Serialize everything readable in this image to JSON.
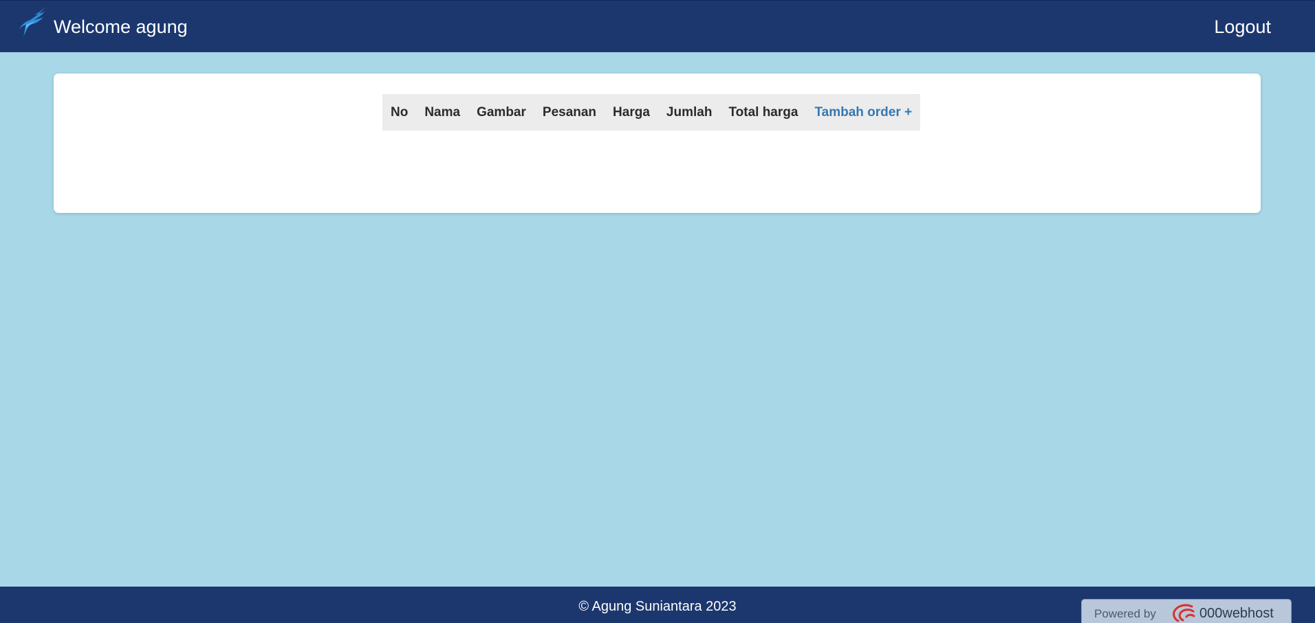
{
  "header": {
    "logo_icon": "bird-logo-icon",
    "welcome_text": "Welcome agung",
    "logout_label": "Logout"
  },
  "table": {
    "columns": [
      "No",
      "Nama",
      "Gambar",
      "Pesanan",
      "Harga",
      "Jumlah",
      "Total harga"
    ],
    "add_order_label": "Tambah order +",
    "rows": []
  },
  "footer": {
    "copyright": "© Agung Suniantara 2023",
    "powered_by_label": "Powered by",
    "powered_by_brand": "000webhost",
    "powered_by_icon": "000webhost-logo-icon"
  },
  "colors": {
    "page_background": "#a8d7e7",
    "navbar": "#1b376e",
    "link_accent": "#3578b4"
  }
}
